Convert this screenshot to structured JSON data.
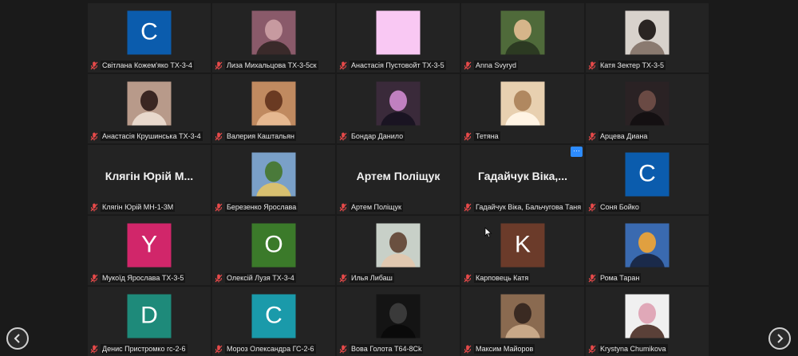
{
  "participants": [
    {
      "name": "Світлана Кожем'яко ТХ-3-4",
      "avatar": {
        "kind": "letter",
        "letter": "C",
        "color": "#0b5cad"
      }
    },
    {
      "name": "Лиза Михальцова ТХ-3-5ск",
      "avatar": {
        "kind": "photo",
        "palette": [
          "#8a5a6a",
          "#c79aa0",
          "#3a2a2a"
        ]
      }
    },
    {
      "name": "Анастасія Пустовойт ТХ-3-5",
      "avatar": {
        "kind": "solid",
        "color": "#f9c8f3"
      }
    },
    {
      "name": "Anna Svyryd",
      "avatar": {
        "kind": "photo",
        "palette": [
          "#4f6a3a",
          "#d6b58a",
          "#2c3a22"
        ]
      }
    },
    {
      "name": "Катя Зектер ТХ-3-5",
      "avatar": {
        "kind": "photo",
        "palette": [
          "#d8d2cc",
          "#2a2422",
          "#8a7a70"
        ]
      }
    },
    {
      "name": "Анастасія Крушинська ТХ-3-4",
      "avatar": {
        "kind": "photo",
        "palette": [
          "#b89a8a",
          "#3a2622",
          "#e8d8cc"
        ]
      }
    },
    {
      "name": "Валерия Каштальян",
      "avatar": {
        "kind": "photo",
        "palette": [
          "#c08a60",
          "#6a3a22",
          "#e6b890"
        ]
      }
    },
    {
      "name": "Бондар Данило",
      "avatar": {
        "kind": "photo",
        "palette": [
          "#3a2a3a",
          "#c080c0",
          "#1a1422"
        ]
      }
    },
    {
      "name": "Тетяна",
      "avatar": {
        "kind": "photo",
        "palette": [
          "#e8d0b0",
          "#b08860",
          "#fff4e4"
        ]
      }
    },
    {
      "name": "Арцева Диана",
      "avatar": {
        "kind": "photo",
        "palette": [
          "#2a2224",
          "#6a4a44",
          "#141012"
        ]
      }
    },
    {
      "name": "Клягін Юрій МН-1-3М",
      "display": "Клягін Юрій М...",
      "avatar": {
        "kind": "none"
      }
    },
    {
      "name": "Березенко Ярослава",
      "avatar": {
        "kind": "photo",
        "palette": [
          "#7aa0c8",
          "#4a7a3a",
          "#d8c070"
        ]
      }
    },
    {
      "name": "Артем Поліщук",
      "display": "Артем Поліщук",
      "avatar": {
        "kind": "none"
      }
    },
    {
      "name": "Гадайчук Віка, Бальчугова Таня",
      "display": "Гадайчук Віка,...",
      "avatar": {
        "kind": "none"
      },
      "more": "···"
    },
    {
      "name": "Соня Бойко",
      "avatar": {
        "kind": "letter",
        "letter": "C",
        "color": "#0b5cad"
      }
    },
    {
      "name": "Мукоїд Ярослава ТХ-3-5",
      "avatar": {
        "kind": "letter",
        "letter": "Y",
        "color": "#d1266a"
      }
    },
    {
      "name": "Олексій Лузя ТХ-3-4",
      "avatar": {
        "kind": "letter",
        "letter": "O",
        "color": "#3b7a2a"
      }
    },
    {
      "name": "Илья Либаш",
      "avatar": {
        "kind": "photo",
        "palette": [
          "#c8d0c8",
          "#6a5040",
          "#e0c8b0"
        ]
      }
    },
    {
      "name": "Карповець Катя",
      "avatar": {
        "kind": "letter",
        "letter": "K",
        "color": "#6b3b2a"
      }
    },
    {
      "name": "Рома Таран",
      "avatar": {
        "kind": "photo",
        "palette": [
          "#3a6ab0",
          "#e0a040",
          "#1a2a4a"
        ]
      }
    },
    {
      "name": "Денис Пристромко гс-2-6",
      "avatar": {
        "kind": "letter",
        "letter": "D",
        "color": "#1e8a7a"
      }
    },
    {
      "name": "Мороз Олександра ГС-2-6",
      "avatar": {
        "kind": "letter",
        "letter": "C",
        "color": "#1a9aaa"
      }
    },
    {
      "name": "Вова Голота Т64-8Сk",
      "avatar": {
        "kind": "photo",
        "palette": [
          "#141414",
          "#3a3a3a",
          "#0a0a0a"
        ]
      }
    },
    {
      "name": "Максим Майоров",
      "avatar": {
        "kind": "photo",
        "palette": [
          "#8a6a50",
          "#3a2a22",
          "#c8a888"
        ]
      }
    },
    {
      "name": "Krystyna Chumikova",
      "avatar": {
        "kind": "photo",
        "palette": [
          "#f0f0f0",
          "#e0a8b8",
          "#5a4038"
        ]
      }
    }
  ],
  "nav": {
    "left": "‹",
    "right": "›"
  }
}
